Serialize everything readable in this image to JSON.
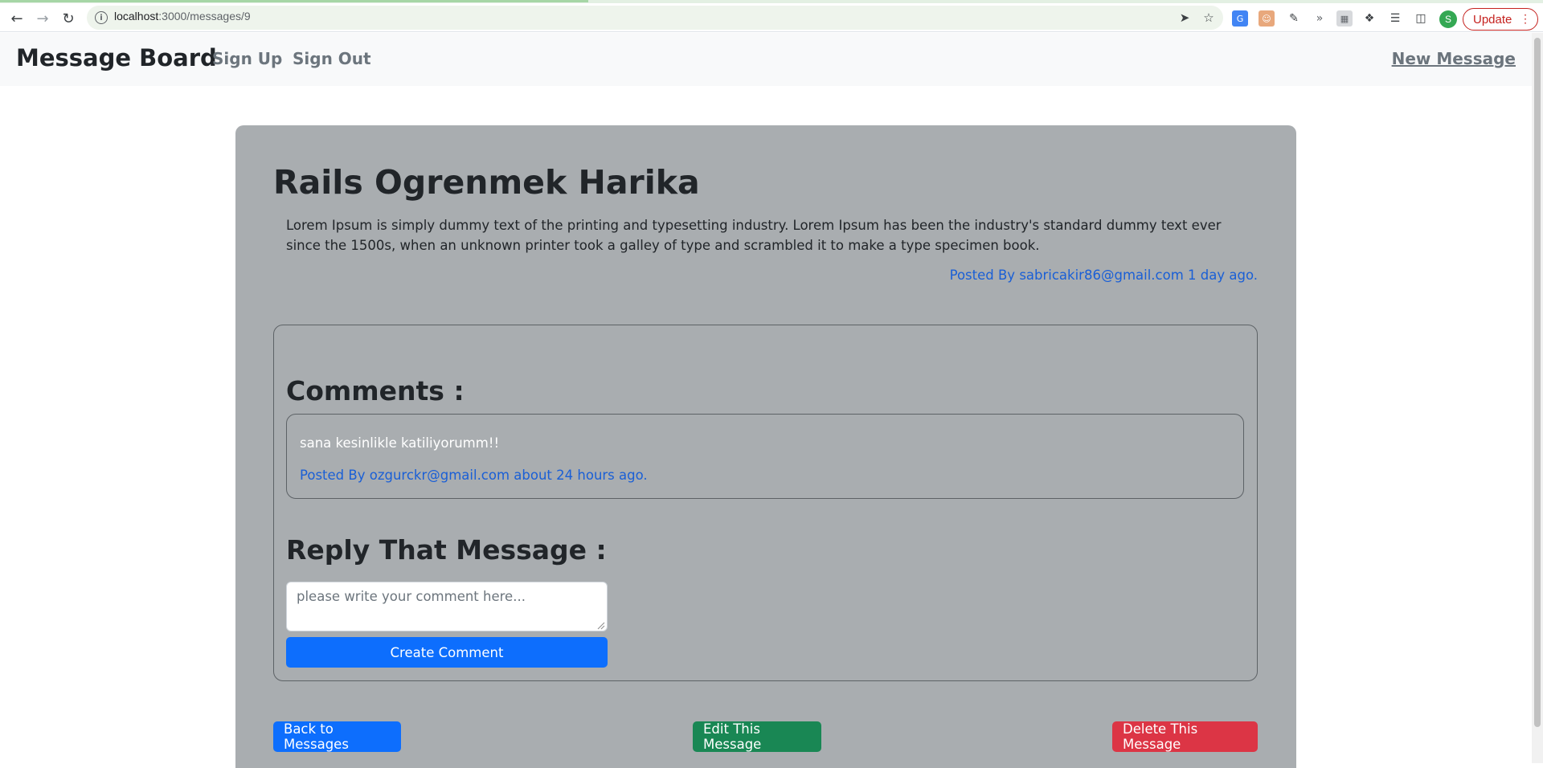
{
  "browser": {
    "url_host": "localhost",
    "url_path": ":3000/messages/9",
    "update_label": "Update",
    "profile_initial": "S",
    "accent_color": "#c5221f"
  },
  "navbar": {
    "brand": "Message Board",
    "links": [
      {
        "label": "Sign Up"
      },
      {
        "label": "Sign Out"
      }
    ],
    "new_message": "New Message"
  },
  "message": {
    "title": "Rails Ogrenmek Harika",
    "body": "Lorem Ipsum is simply dummy text of the printing and typesetting industry. Lorem Ipsum has been the industry's standard dummy text ever since the 1500s, when an unknown printer took a galley of type and scrambled it to make a type specimen book.",
    "meta": "Posted By sabricakir86@gmail.com 1 day ago."
  },
  "comments": {
    "title": "Comments :",
    "items": [
      {
        "text": "sana kesinlikle katiliyorumm!!",
        "meta": "Posted By ozgurckr@gmail.com about 24 hours ago."
      }
    ]
  },
  "reply": {
    "title": "Reply That Message :",
    "placeholder": "please write your comment here...",
    "submit_label": "Create Comment"
  },
  "actions": {
    "back": "Back to Messages",
    "edit": "Edit This Message",
    "delete": "Delete This Message"
  },
  "colors": {
    "card_bg": "#a9adb0",
    "primary": "#0d6efd",
    "success": "#198754",
    "danger": "#dc3545",
    "link": "#1a5fd6"
  }
}
